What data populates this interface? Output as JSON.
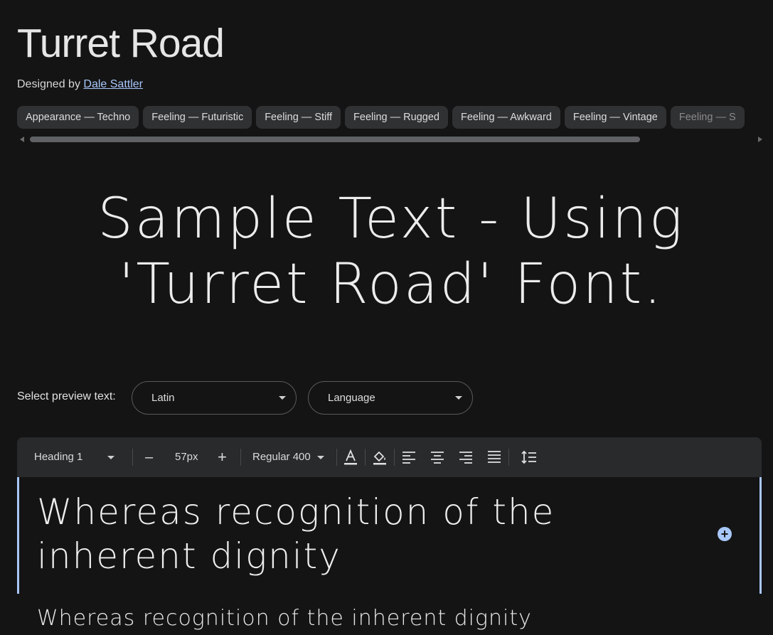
{
  "font": {
    "title": "Turret Road",
    "designed_by_label": "Designed by",
    "designer": "Dale Sattler"
  },
  "tags": [
    "Appearance — Techno",
    "Feeling — Futuristic",
    "Feeling — Stiff",
    "Feeling — Rugged",
    "Feeling — Awkward",
    "Feeling — Vintage",
    "Feeling — S"
  ],
  "sample_text": "Sample Text - Using 'Turret Road' Font.",
  "preview": {
    "label": "Select preview text:",
    "script_select": "Latin",
    "language_select": "Language"
  },
  "toolbar": {
    "style": "Heading 1",
    "decrease": "–",
    "size": "57px",
    "increase": "+",
    "weight": "Regular 400"
  },
  "editor": {
    "heading_text": "Whereas recognition of the inherent dignity",
    "body_text": "Whereas recognition of the inherent dignity"
  },
  "colors": {
    "background": "#141414",
    "accent": "#a8c7fa",
    "chip": "#2f3133",
    "toolbar": "#282a2c"
  },
  "icons": [
    "text-color-icon",
    "fill-color-icon",
    "align-left-icon",
    "align-center-icon",
    "align-right-icon",
    "align-justify-icon",
    "line-spacing-icon",
    "add-circle-icon"
  ]
}
